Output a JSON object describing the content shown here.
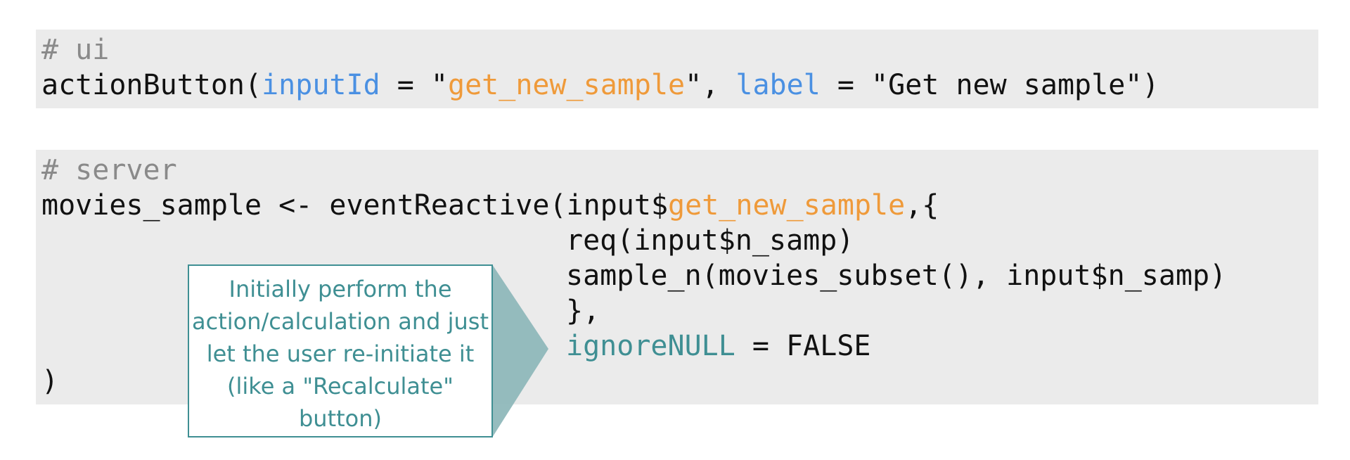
{
  "ui_block": {
    "comment": "# ui",
    "line1": {
      "fn": "actionButton(",
      "arg1": "inputId",
      "eq1": " = \"",
      "val1": "get_new_sample",
      "sep": "\", ",
      "arg2": "label",
      "rest": " = \"Get new sample\")"
    }
  },
  "server_block": {
    "comment": "# server",
    "line1": {
      "pre": "movies_sample <- eventReactive(input$",
      "id": "get_new_sample",
      "post": ",{"
    },
    "line2": "req(input$n_samp)",
    "line3": "sample_n(movies_subset(), input$n_samp)",
    "line4": "},",
    "line5": {
      "arg": "ignoreNULL",
      "rest": " = FALSE"
    },
    "line6": ")"
  },
  "callout": {
    "text": "Initially perform the action/calculation and just let the user re-initiate it (like a \"Recalculate\" button)"
  },
  "colors": {
    "code_bg": "#ebebeb",
    "comment": "#8a8a8a",
    "argument": "#4a90e2",
    "string": "#ef9a3a",
    "callout_teal": "#3f8f93",
    "callout_fill": "#8fb8ba"
  }
}
